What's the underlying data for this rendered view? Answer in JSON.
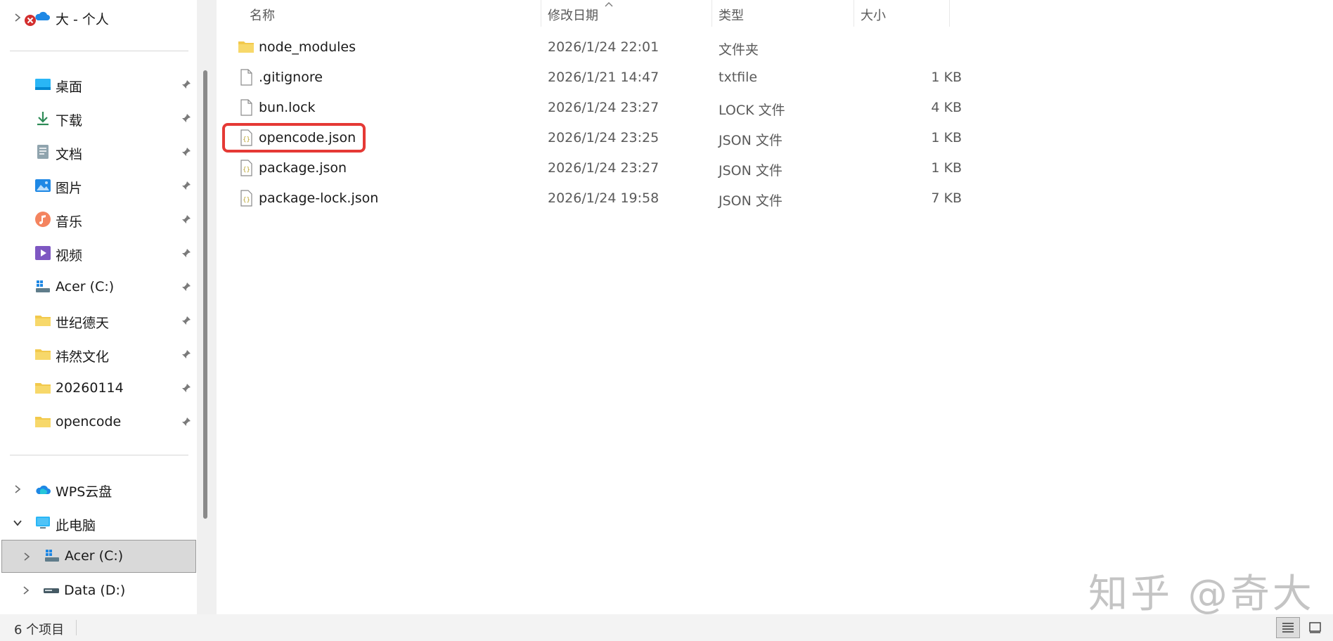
{
  "sidebar": {
    "top_item": {
      "label": "大 - 个人",
      "icon": "onedrive-cloud-icon",
      "badge": "error-x-icon"
    },
    "quick_access": [
      {
        "label": "桌面",
        "icon": "desktop-icon"
      },
      {
        "label": "下载",
        "icon": "download-icon"
      },
      {
        "label": "文档",
        "icon": "document-icon"
      },
      {
        "label": "图片",
        "icon": "pictures-icon"
      },
      {
        "label": "音乐",
        "icon": "music-icon"
      },
      {
        "label": "视频",
        "icon": "video-icon"
      },
      {
        "label": "Acer (C:)",
        "icon": "drive-icon"
      },
      {
        "label": "世纪德天",
        "icon": "folder-icon"
      },
      {
        "label": "祎然文化",
        "icon": "folder-icon"
      },
      {
        "label": "20260114",
        "icon": "folder-icon"
      },
      {
        "label": "opencode",
        "icon": "folder-icon"
      }
    ],
    "locations": [
      {
        "label": "WPS云盘",
        "icon": "wps-cloud-icon",
        "expanded": false
      },
      {
        "label": "此电脑",
        "icon": "computer-icon",
        "expanded": true
      },
      {
        "label": "Acer (C:)",
        "icon": "drive-icon",
        "expanded": false,
        "selected": true
      },
      {
        "label": "Data (D:)",
        "icon": "disk-icon",
        "expanded": false
      }
    ]
  },
  "columns": {
    "name": "名称",
    "modified": "修改日期",
    "type": "类型",
    "size": "大小"
  },
  "files": [
    {
      "name": "node_modules",
      "modified": "2026/1/24 22:01",
      "type": "文件夹",
      "size": "",
      "icon": "folder-icon"
    },
    {
      "name": ".gitignore",
      "modified": "2026/1/21 14:47",
      "type": "txtfile",
      "size": "1 KB",
      "icon": "file-icon"
    },
    {
      "name": "bun.lock",
      "modified": "2026/1/24 23:27",
      "type": "LOCK 文件",
      "size": "4 KB",
      "icon": "file-icon"
    },
    {
      "name": "opencode.json",
      "modified": "2026/1/24 23:25",
      "type": "JSON 文件",
      "size": "1 KB",
      "icon": "json-file-icon",
      "highlighted": true
    },
    {
      "name": "package.json",
      "modified": "2026/1/24 23:27",
      "type": "JSON 文件",
      "size": "1 KB",
      "icon": "json-file-icon"
    },
    {
      "name": "package-lock.json",
      "modified": "2026/1/24 19:58",
      "type": "JSON 文件",
      "size": "7 KB",
      "icon": "json-file-icon"
    }
  ],
  "status": {
    "item_count": "6 个项目"
  },
  "watermark": "知乎 @奇大",
  "colors": {
    "highlight": "#e53935",
    "selected_bg": "#d9d9d9",
    "folder": "#f2c94c"
  }
}
